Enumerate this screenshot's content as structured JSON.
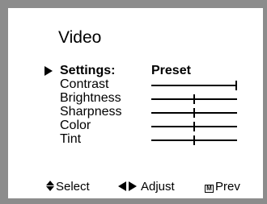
{
  "menu": {
    "title": "Video",
    "settings": {
      "label": "Settings:",
      "value": "Preset"
    },
    "items": [
      {
        "label": "Contrast",
        "level": 1.0
      },
      {
        "label": "Brightness",
        "level": 0.5
      },
      {
        "label": "Sharpness",
        "level": 0.5
      },
      {
        "label": "Color",
        "level": 0.5
      },
      {
        "label": "Tint",
        "level": 0.5
      }
    ]
  },
  "help": {
    "select_label": "Select",
    "adjust_label": "Adjust",
    "prev_label": "Prev",
    "menu_glyph": "M"
  },
  "icons": {
    "cursor": "right-triangle-icon",
    "select": "up-down-arrows-icon",
    "adjust": "left-right-arrows-icon",
    "prev": "menu-button-icon"
  }
}
